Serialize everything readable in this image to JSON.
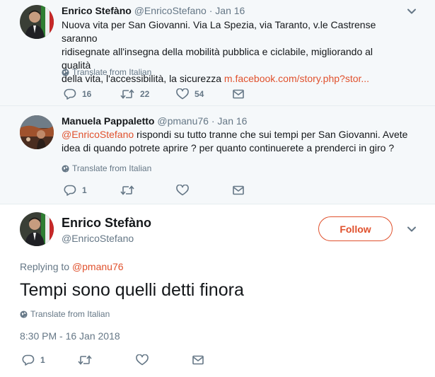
{
  "tweets": [
    {
      "name": "Enrico Stefàno",
      "handle": "@EnricoStefano",
      "separator": "·",
      "date": "Jan 16",
      "text_lines": [
        "Nuova vita per San Giovanni. Via La Spezia, via Taranto, v.le Castrense saranno",
        "ridisegnate all'insegna della mobilità pubblica e ciclabile, migliorando al qualità",
        "della vita, l'accessibilità, la sicurezza "
      ],
      "link": "m.facebook.com/story.php?stor...",
      "translate": "Translate from Italian",
      "actions": {
        "replies": "16",
        "retweets": "22",
        "likes": "54"
      },
      "icons": [
        "reply-icon",
        "retweet-icon",
        "like-icon",
        "mail-icon",
        "chevron-down-icon",
        "globe-icon"
      ]
    },
    {
      "name": "Manuela Pappaletto",
      "handle": "@pmanu76",
      "separator": "·",
      "date": "Jan 16",
      "mention": "@EnricoStefano",
      "text_line1_rest": " rispondi su tutto tranne che sui tempi per San Giovanni. Avete",
      "text_line2": "idea di quando potrete aprire ? per quanto continuerete a prenderci in giro ?",
      "translate": "Translate from Italian",
      "actions": {
        "replies": "1",
        "retweets": "",
        "likes": ""
      }
    }
  ],
  "main_tweet": {
    "name": "Enrico Stefàno",
    "handle": "@EnricoStefano",
    "follow_label": "Follow",
    "replying_prefix": "Replying to ",
    "replying_to": "@pmanu76",
    "text": "Tempi sono quelli detti finora",
    "translate": "Translate from Italian",
    "timestamp": "8:30 PM - 16 Jan 2018",
    "actions": {
      "replies": "1",
      "retweets": "",
      "likes": ""
    }
  },
  "colors": {
    "accent": "#e0512d",
    "thread_line": "#f4a08a",
    "muted": "#657786",
    "text": "#14171a",
    "background_alt": "#f5f8fa"
  }
}
